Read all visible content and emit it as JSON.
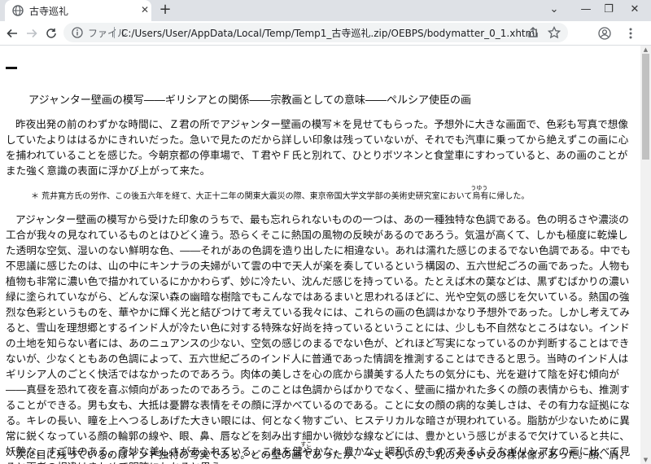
{
  "tab": {
    "title": "古寺巡礼",
    "close": "✕",
    "new": "+"
  },
  "window": {
    "minimize": "⌄",
    "min2": "—",
    "restore": "❐",
    "close": "✕"
  },
  "toolbar": {
    "file_label": "ファイル",
    "url": "C:/Users/User/AppData/Local/Temp/Temp1_古寺巡礼.zip/OEBPS/bodymatter_0_1.xhtml"
  },
  "doc": {
    "heading": "アジャンター壁画の模写――ギリシアとの関係――宗教画としての意味――ペルシア使臣の画",
    "para1": "昨夜出発の前のわずかな時間に、Ｚ君の所でアジャンター壁画の模写＊を見せてもらった。予想外に大きな画面で、色彩も写真で想像していたよりははるかにきれいだった。急いで見たのだから詳しい印象は残っていないが、それでも汽車に乗ってから絶えずこの画に心を捕われていることを感じた。今朝京都の停車場で、Ｔ君やＦ氏と別れて、ひとりボツネンと食堂車にすわっていると、あの画のことがまた強く意識の表面に浮かび上がって来た。",
    "note_before": "＊ 荒井寛方氏の労作、この後五六年を経て、大正十二年の関東大震災の際、東京帝国大学文学部の美術史研究室において",
    "note_ruby_base": "烏有",
    "note_ruby_text": "うゆう",
    "note_after": "に帰した。",
    "para2_before": "アジャンター壁画の模写から受けた印象のうちで、最も忘れられないものの一つは、あの一種独特な色調である。色の明るさや濃淡の工合が我々の見なれているものとはひどく違う。恐らくそこに熱国の風物の反映があるのであろう。気温が高くて、しかも極度に乾燥した透明な空気、湿いのない鮮明な色、――それがあの色調を造り出したに相違ない。あれは濡れた感じのまるでない色調である。中でも不思議に感じたのは、山の中にキンナラの夫婦がいて雲の中で天人が楽を奏しているという構図の、五六世紀ごろの画であった。人物も植物も非常に濃い色で描かれているにかかわらず、妙に冷たい、沈んだ感じを持っている。たとえば木の葉などは、黒ずむばかりの濃い緑に塗られていながら、どんな深い森の幽暗な樹陰でもこんなではあるまいと思われるほどに、光や空気の感じを欠いている。熱国の強烈な色彩というものを、華やかに輝く光と結びつけて考えている我々には、これらの画の色調はかなり予想外であった。しかし考えてみると、雪山を理想郷とするインド人が冷たい色に対する特殊な好尚を持っているということには、少しも不自然なところはない。インドの土地を知らない者には、あのニュアンスの少ない、空気の感じのまるでない色が、どれほど写実になっているのか判断することはできないが、少なくともあの色調によって、五六世紀ごろのインド人に普通であった情調を推測することはできると思う。当時のインド人はギリシア人のごとく快活ではなかったのであろう。肉体の美しさを心の底から讃美する人たちの気分にも、光を避けて陰を好む傾向が――真昼を恐れて夜を喜ぶ傾向があったのであろう。このことは色調からばかりでなく、壁画に描かれた多くの顔の表情からも、推測することができる。男も女も、大抵は憂欝な表情をその顔に浮かべているのである。ことに女の顔の病的な美しさは、その有力な証拠になる。キレの長い、瞳を上へつるしあげた大きい眼には、何となく物すごい、ヒステリカルな暗さが現われている。脂肪が少ないために異常に鋭くなっている顔の輪郭の線や、眼、鼻、唇などを刻み出す細かい微妙な線などには、豊かという感じがまるで欠けていると共に、妖艶な、すご味のある、奇妙な美しさがあふれている。これを",
    "para2_ruby_base": "健",
    "para2_ruby_text": "すこ",
    "para2_after": "やかな、豊かな、調和そのものであるようなギリシア女の画に比べて見ると両者の相違はきわめて明瞭にわかると思う。",
    "para3": "次に目に残っているのはインド独特の写実である。どの壁の画であったか、一丈ぐらいの、乳の大きい女の裸体像があった。顔、肩、腕、"
  }
}
